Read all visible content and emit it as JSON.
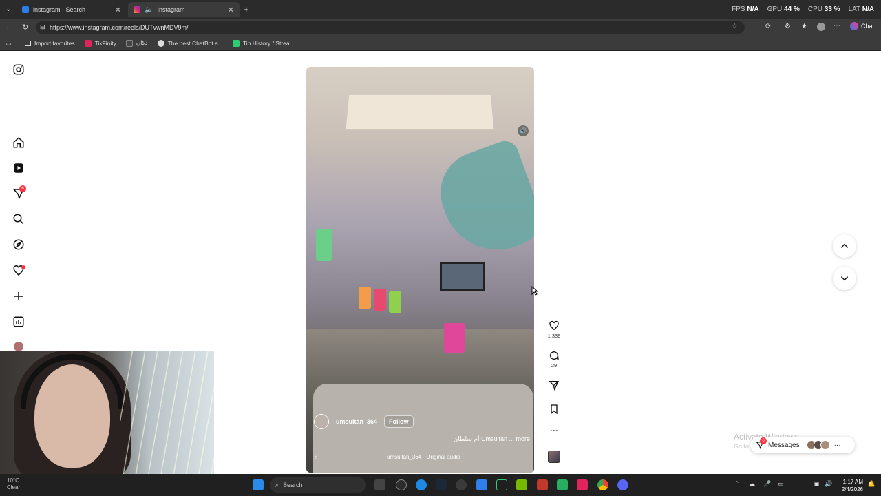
{
  "browser": {
    "tabs": [
      {
        "label": "instagram - Search",
        "active": false
      },
      {
        "label": "Instagram",
        "active": true
      }
    ],
    "url": "https://www.instagram.com/reels/DUTvwnMDV9m/",
    "chat_label": "Chat",
    "stats": {
      "fps_label": "FPS",
      "fps": "N/A",
      "gpu_label": "GPU",
      "gpu": "44 %",
      "cpu_label": "CPU",
      "cpu": "33 %",
      "lat_label": "LAT",
      "lat": "N/A"
    },
    "favorites": [
      {
        "label": "Import favorites"
      },
      {
        "label": "TikFinity"
      },
      {
        "label": "دكان"
      },
      {
        "label": "The best ChatBot a..."
      },
      {
        "label": "Tip History / Strea..."
      }
    ]
  },
  "reel": {
    "username": "umsultan_364",
    "follow_label": "Follow",
    "caption": "أم سلطان Umsultan ... more",
    "audio": "umsultan_364 · Original audio",
    "likes": "1,339",
    "comments": "29"
  },
  "sidebar": {
    "notif_badge": "6"
  },
  "messages": {
    "label": "Messages",
    "badge": "6"
  },
  "watermark": {
    "line1": "Activate Windows",
    "line2": "Go to Settings to activate Windows."
  },
  "taskbar": {
    "search_placeholder": "Search",
    "weather_temp": "10°C",
    "weather_desc": "Clear",
    "time": "1:17 AM",
    "date": "2/4/2026"
  },
  "colors": {
    "badge_red": "#ff3040",
    "chrome_dark": "#2b2b2b"
  }
}
